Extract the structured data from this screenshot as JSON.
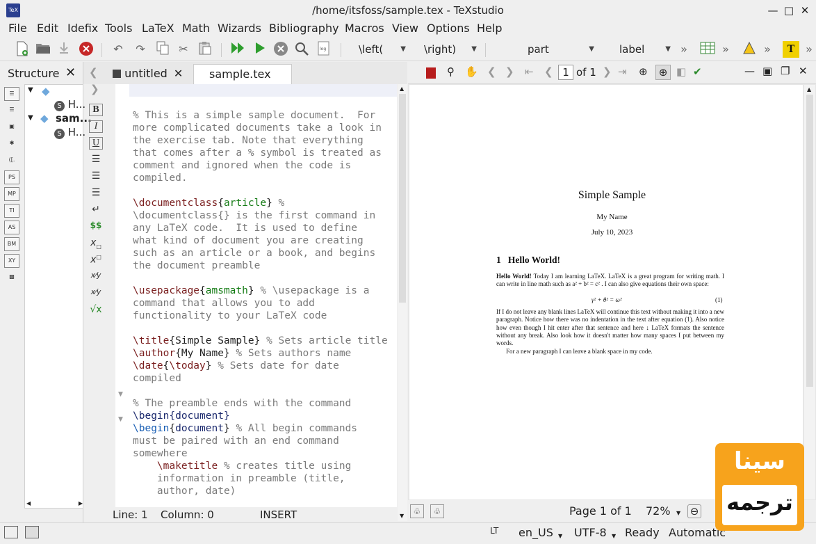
{
  "window": {
    "title": "/home/itsfoss/sample.tex - TeXstudio",
    "minimize_icon": "minimize-icon",
    "maximize_icon": "maximize-icon",
    "close_icon": "close-icon"
  },
  "menubar": [
    "File",
    "Edit",
    "Idefix",
    "Tools",
    "LaTeX",
    "Math",
    "Wizards",
    "Bibliography",
    "Macros",
    "View",
    "Options",
    "Help"
  ],
  "toolbar": {
    "left_delim": "\\left(",
    "right_delim": "\\right)",
    "sectioning": "part",
    "references": "label",
    "overflow": "»"
  },
  "structure": {
    "title": "Structure",
    "tree": [
      {
        "label": "H...",
        "level": 1
      },
      {
        "label": "sam...",
        "level": 0,
        "bold": true
      },
      {
        "label": "H...",
        "level": 1
      }
    ],
    "side_icons": [
      "list-icon",
      "toc-icon",
      "bookmark-icon",
      "symbols-icon",
      "brackets-icon",
      "PS",
      "MP",
      "TI",
      "AS",
      "BM",
      "XY",
      "special-icon"
    ]
  },
  "editor": {
    "tabs": [
      {
        "label": "untitled",
        "active": false
      },
      {
        "label": "sample.tex",
        "active": true
      }
    ],
    "format_buttons": [
      "B",
      "I",
      "U"
    ],
    "status": {
      "line": "Line: 1",
      "column": "Column: 0",
      "mode": "INSERT"
    }
  },
  "pdf": {
    "page_input": "1",
    "page_of": "of 1",
    "zoom": "72%",
    "page_label": "Page 1 of 1",
    "doc": {
      "title": "Simple Sample",
      "author": "My Name",
      "date": "July 10, 2023",
      "section_number": "1",
      "section_title": "Hello World!",
      "para1_bold": "Hello World!",
      "para1_rest": "Today I am learning LaTeX. LaTeX is a great program for writing math. I can write in line math such as a² + b² = c² . I can also give equations their own space:",
      "equation": "γ² + θ² = ω²",
      "equation_number": "(1)",
      "para2": "If I do not leave any blank lines LaTeX will continue this text without making it into a new paragraph. Notice how there was no indentation in the text after equation (1). Also notice how even though I hit enter after that sentence and here ↓ LaTeX formats the sentence without any break. Also look how it doesn't matter how many spaces I put between my words.",
      "para3": "For a new paragraph I can leave a blank space in my code."
    }
  },
  "statusbar": {
    "lt": "LT",
    "language": "en_US",
    "encoding": "UTF-8",
    "state": "Ready",
    "compile": "Automatic"
  },
  "watermark": {
    "top_text": "سینا",
    "bottom_text": "ترجمه",
    "color": "#f7a31c"
  }
}
